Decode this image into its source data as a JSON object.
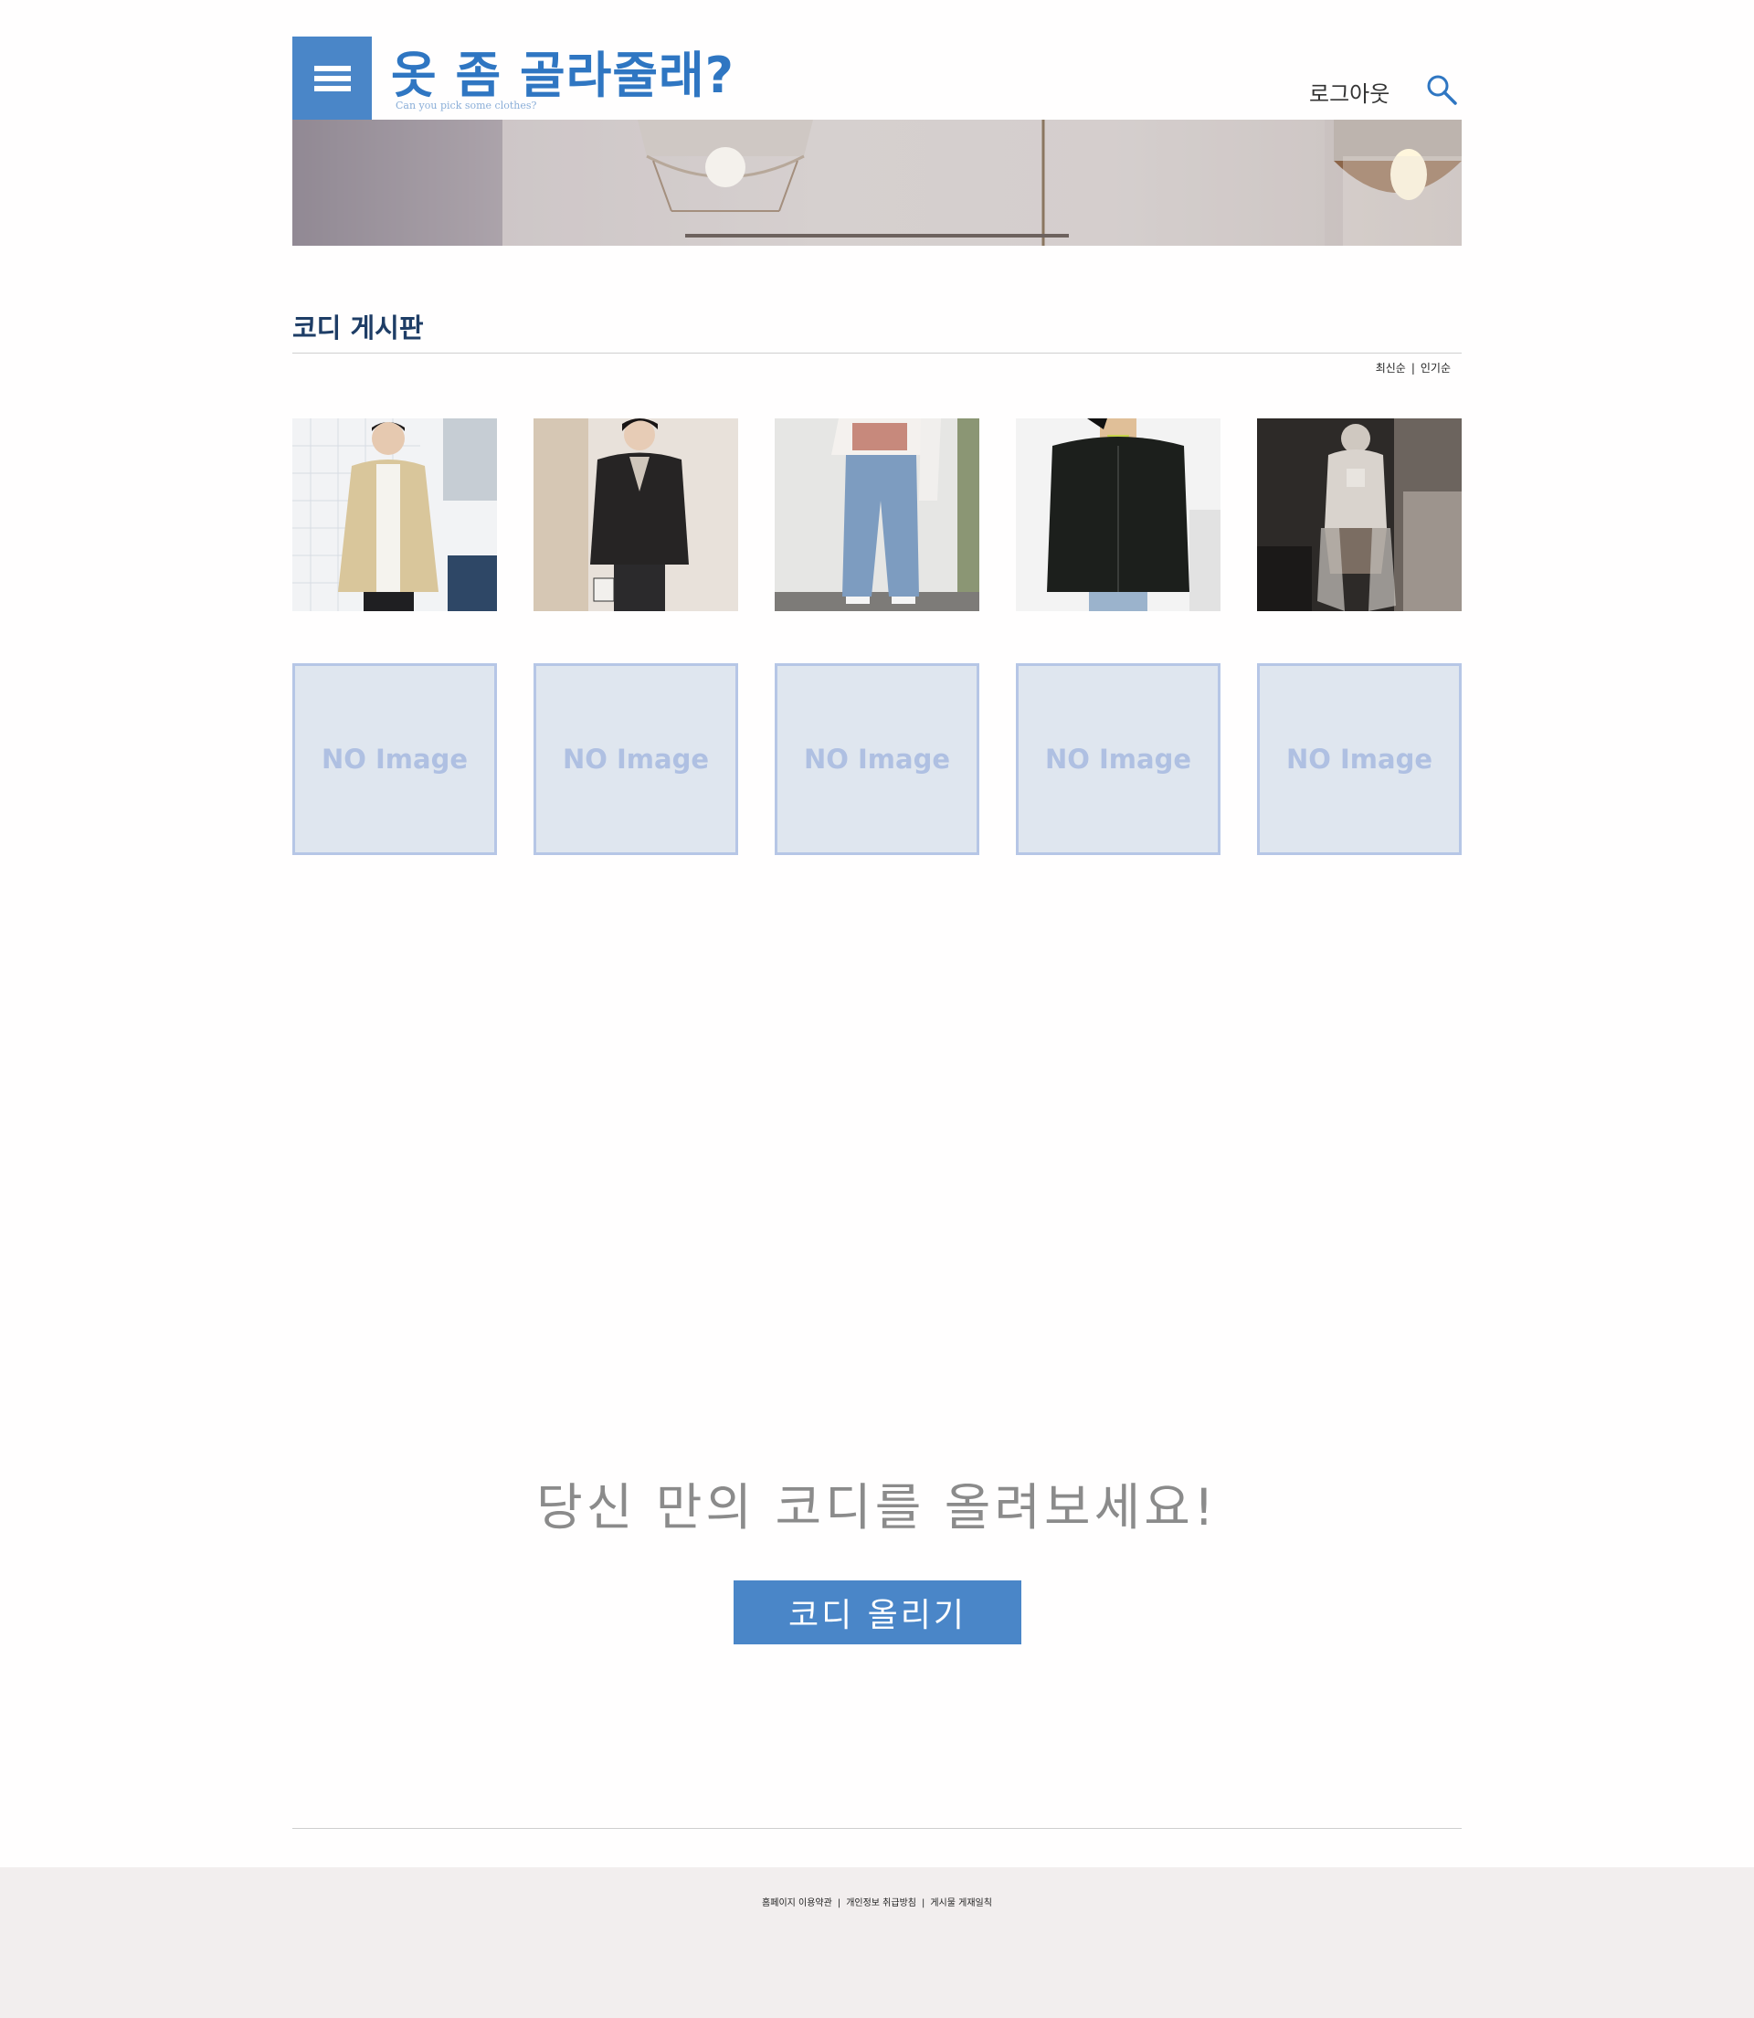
{
  "header": {
    "logo_title": "옷 좀 골라줄래?",
    "logo_subtitle": "Can you pick some clothes?",
    "logout_label": "로그아웃"
  },
  "board": {
    "title": "코디 게시판",
    "sort_latest": "최신순",
    "sort_separator": "|",
    "sort_popular": "인기순",
    "placeholder_label": "NO Image",
    "cta_text": "당신 만의 코디를 올려보세요!",
    "cta_button": "코디 올리기"
  },
  "footer": {
    "link_terms": "홈페이지 이용약관",
    "link_privacy": "개인정보 취급방침",
    "link_posting": "게시물 게재일칙",
    "separator": "|"
  },
  "colors": {
    "accent": "#4a86c8",
    "logo_text": "#2f76c2",
    "board_title": "#1e3d66",
    "placeholder_bg": "#dfe6ef",
    "placeholder_border": "#b6c6e6",
    "footer_bg": "#f2eeee"
  },
  "icons": {
    "menu": "hamburger-menu-icon",
    "search": "search-icon"
  }
}
